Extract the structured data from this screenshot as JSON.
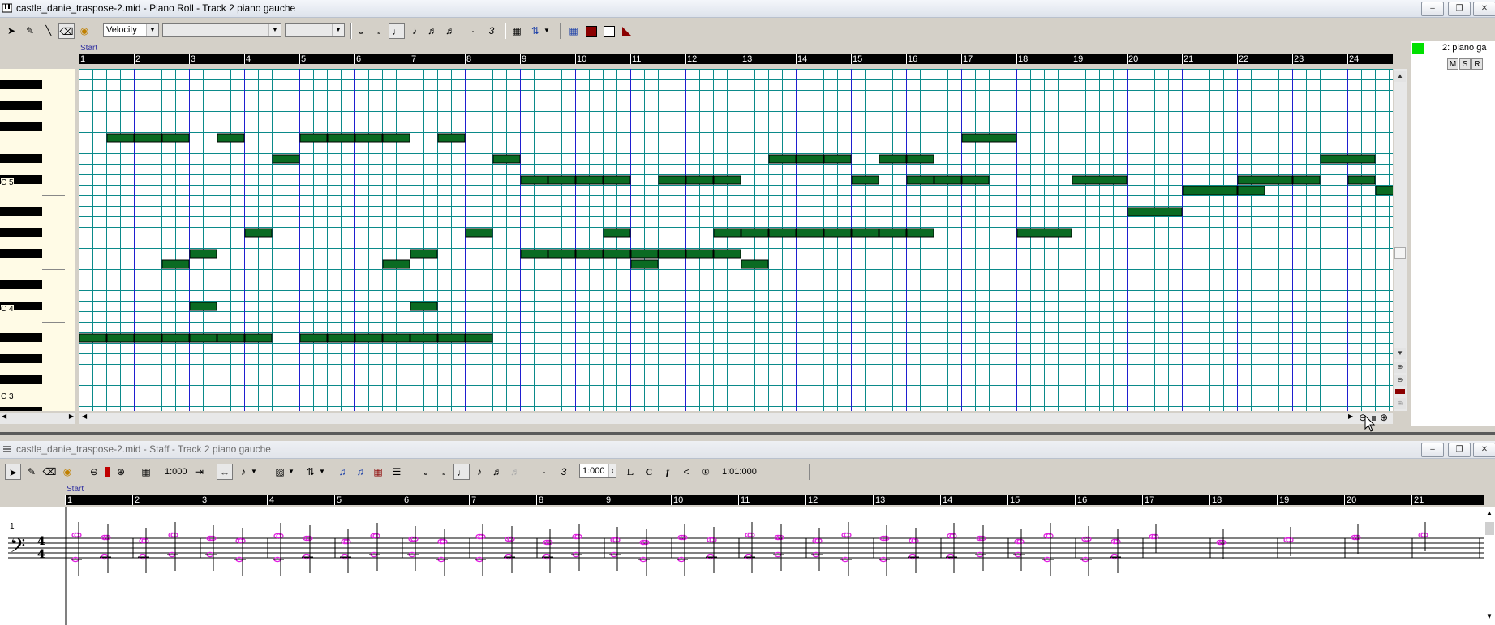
{
  "piano_roll": {
    "title": "castle_danie_traspose-2.mid - Piano Roll - Track 2 piano gauche",
    "toolbar": {
      "velocity_combo": "Velocity",
      "combo2": "",
      "combo3": ""
    },
    "marker_start": "Start",
    "measures": [
      "1",
      "2",
      "3",
      "4",
      "5",
      "6",
      "7",
      "8",
      "9",
      "10",
      "11",
      "12",
      "13",
      "14",
      "15",
      "16",
      "17",
      "18",
      "19",
      "20",
      "21",
      "22",
      "23",
      "24"
    ],
    "key_labels": [
      "C 5",
      "C 4",
      "C 3"
    ],
    "track": {
      "name": "2: piano ga",
      "m": "M",
      "s": "S",
      "r": "R",
      "color": "#00e000"
    },
    "note_color": "#0a6b22",
    "grid_colors": {
      "beat": "#0b8a8a",
      "bar": "#1f1fd0",
      "background": "#ffffff"
    },
    "notes": [
      {
        "row": 6,
        "start": 0.5,
        "len": 0.5
      },
      {
        "row": 6,
        "start": 1,
        "len": 0.5
      },
      {
        "row": 6,
        "start": 1.5,
        "len": 0.5
      },
      {
        "row": 6,
        "start": 2.5,
        "len": 0.5
      },
      {
        "row": 6,
        "start": 4,
        "len": 0.5
      },
      {
        "row": 6,
        "start": 4.5,
        "len": 0.5
      },
      {
        "row": 6,
        "start": 5,
        "len": 0.5
      },
      {
        "row": 6,
        "start": 5.5,
        "len": 0.5
      },
      {
        "row": 6,
        "start": 6.5,
        "len": 0.5
      },
      {
        "row": 6,
        "start": 16,
        "len": 1
      },
      {
        "row": 8,
        "start": 3.5,
        "len": 0.5
      },
      {
        "row": 8,
        "start": 7.5,
        "len": 0.5
      },
      {
        "row": 8,
        "start": 12.5,
        "len": 0.5
      },
      {
        "row": 8,
        "start": 13,
        "len": 0.5
      },
      {
        "row": 8,
        "start": 13.5,
        "len": 0.5
      },
      {
        "row": 8,
        "start": 14.5,
        "len": 0.5
      },
      {
        "row": 8,
        "start": 15,
        "len": 0.5
      },
      {
        "row": 8,
        "start": 22.5,
        "len": 1
      },
      {
        "row": 10,
        "start": 8,
        "len": 0.5
      },
      {
        "row": 10,
        "start": 8.5,
        "len": 0.5
      },
      {
        "row": 10,
        "start": 9,
        "len": 0.5
      },
      {
        "row": 10,
        "start": 9.5,
        "len": 0.5
      },
      {
        "row": 10,
        "start": 10.5,
        "len": 0.5
      },
      {
        "row": 10,
        "start": 11,
        "len": 0.5
      },
      {
        "row": 10,
        "start": 11.5,
        "len": 0.5
      },
      {
        "row": 10,
        "start": 14,
        "len": 0.5
      },
      {
        "row": 10,
        "start": 15,
        "len": 0.5
      },
      {
        "row": 10,
        "start": 15.5,
        "len": 0.5
      },
      {
        "row": 10,
        "start": 16,
        "len": 0.5
      },
      {
        "row": 10,
        "start": 18,
        "len": 1
      },
      {
        "row": 10,
        "start": 21,
        "len": 1
      },
      {
        "row": 10,
        "start": 22,
        "len": 0.5
      },
      {
        "row": 10,
        "start": 23,
        "len": 0.5
      },
      {
        "row": 11,
        "start": 20,
        "len": 1
      },
      {
        "row": 11,
        "start": 21,
        "len": 0.5
      },
      {
        "row": 11,
        "start": 23.5,
        "len": 0.35
      },
      {
        "row": 13,
        "start": 19,
        "len": 1
      },
      {
        "row": 15,
        "start": 3,
        "len": 0.5
      },
      {
        "row": 15,
        "start": 7,
        "len": 0.5
      },
      {
        "row": 15,
        "start": 9.5,
        "len": 0.5
      },
      {
        "row": 15,
        "start": 11.5,
        "len": 0.5
      },
      {
        "row": 15,
        "start": 12,
        "len": 0.5
      },
      {
        "row": 15,
        "start": 12.5,
        "len": 0.5
      },
      {
        "row": 15,
        "start": 13,
        "len": 0.5
      },
      {
        "row": 15,
        "start": 13.5,
        "len": 0.5
      },
      {
        "row": 15,
        "start": 14,
        "len": 0.5
      },
      {
        "row": 15,
        "start": 14.5,
        "len": 0.5
      },
      {
        "row": 15,
        "start": 15,
        "len": 0.5
      },
      {
        "row": 15,
        "start": 17,
        "len": 1
      },
      {
        "row": 17,
        "start": 2,
        "len": 0.5
      },
      {
        "row": 17,
        "start": 6,
        "len": 0.5
      },
      {
        "row": 17,
        "start": 8,
        "len": 0.5
      },
      {
        "row": 17,
        "start": 8.5,
        "len": 0.5
      },
      {
        "row": 17,
        "start": 9,
        "len": 0.5
      },
      {
        "row": 17,
        "start": 9.5,
        "len": 0.5
      },
      {
        "row": 17,
        "start": 10,
        "len": 0.5
      },
      {
        "row": 17,
        "start": 10.5,
        "len": 0.5
      },
      {
        "row": 17,
        "start": 11,
        "len": 0.5
      },
      {
        "row": 17,
        "start": 11.5,
        "len": 0.5
      },
      {
        "row": 18,
        "start": 1.5,
        "len": 0.5
      },
      {
        "row": 18,
        "start": 5.5,
        "len": 0.5
      },
      {
        "row": 18,
        "start": 10,
        "len": 0.5
      },
      {
        "row": 18,
        "start": 12,
        "len": 0.5
      },
      {
        "row": 22,
        "start": 2,
        "len": 0.5
      },
      {
        "row": 22,
        "start": 6,
        "len": 0.5
      },
      {
        "row": 25,
        "start": 0,
        "len": 0.5
      },
      {
        "row": 25,
        "start": 0.5,
        "len": 0.5
      },
      {
        "row": 25,
        "start": 1,
        "len": 0.5
      },
      {
        "row": 25,
        "start": 1.5,
        "len": 0.5
      },
      {
        "row": 25,
        "start": 2,
        "len": 0.5
      },
      {
        "row": 25,
        "start": 2.5,
        "len": 0.5
      },
      {
        "row": 25,
        "start": 3,
        "len": 0.5
      },
      {
        "row": 25,
        "start": 4,
        "len": 0.5
      },
      {
        "row": 25,
        "start": 4.5,
        "len": 0.5
      },
      {
        "row": 25,
        "start": 5,
        "len": 0.5
      },
      {
        "row": 25,
        "start": 5.5,
        "len": 0.5
      },
      {
        "row": 25,
        "start": 6,
        "len": 0.5
      },
      {
        "row": 25,
        "start": 6.5,
        "len": 0.5
      },
      {
        "row": 25,
        "start": 7,
        "len": 0.5
      }
    ]
  },
  "staff": {
    "title": "castle_danie_traspose-2.mid - Staff - Track 2 piano gauche",
    "toolbar": {
      "quantize": "1:000",
      "zoom": "1:000",
      "position": "1:01:000",
      "btn_l": "L",
      "btn_c": "C",
      "btn_f": "f"
    },
    "marker_start": "Start",
    "measures": [
      "1",
      "2",
      "3",
      "4",
      "5",
      "6",
      "7",
      "8",
      "9",
      "10",
      "11",
      "12",
      "13",
      "14",
      "15",
      "16",
      "17",
      "18",
      "19",
      "20",
      "21"
    ],
    "staff_number": "1",
    "time_signature": {
      "top": "4",
      "bottom": "4"
    },
    "note_color": "#e020e0"
  }
}
